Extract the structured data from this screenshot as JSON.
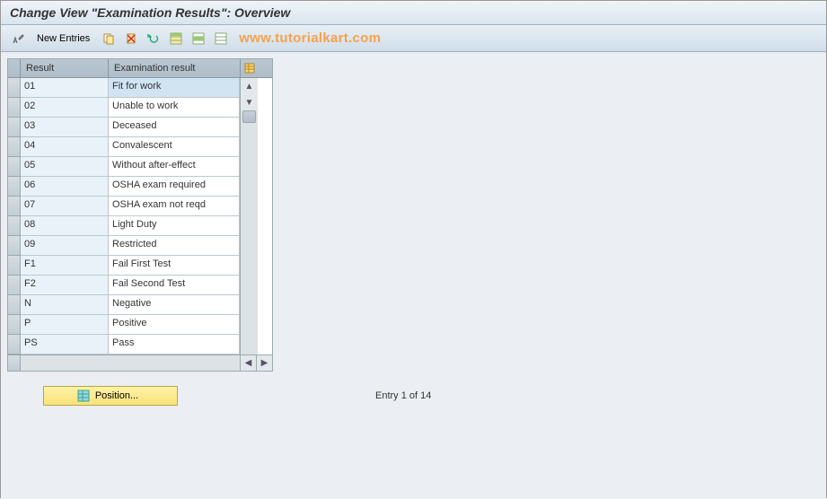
{
  "header": {
    "title": "Change View \"Examination Results\": Overview"
  },
  "toolbar": {
    "edit_icon": "edit",
    "new_entries_label": "New Entries",
    "icons": [
      "copy",
      "delete",
      "undo",
      "select-all",
      "select-block",
      "deselect-all"
    ]
  },
  "watermark": "www.tutorialkart.com",
  "table": {
    "columns": {
      "result": "Result",
      "exam": "Examination result"
    },
    "rows": [
      {
        "result": "01",
        "exam": "Fit for work",
        "selected": true
      },
      {
        "result": "02",
        "exam": "Unable to work"
      },
      {
        "result": "03",
        "exam": "Deceased"
      },
      {
        "result": "04",
        "exam": "Convalescent"
      },
      {
        "result": "05",
        "exam": "Without after-effect"
      },
      {
        "result": "06",
        "exam": "OSHA exam required"
      },
      {
        "result": "07",
        "exam": "OSHA exam not reqd"
      },
      {
        "result": "08",
        "exam": "Light Duty"
      },
      {
        "result": "09",
        "exam": "Restricted"
      },
      {
        "result": "F1",
        "exam": "Fail First Test"
      },
      {
        "result": "F2",
        "exam": "Fail Second Test"
      },
      {
        "result": "N",
        "exam": "Negative"
      },
      {
        "result": "P",
        "exam": "Positive"
      },
      {
        "result": "PS",
        "exam": "Pass"
      }
    ]
  },
  "footer": {
    "position_label": "Position...",
    "entry_status": "Entry 1 of 14"
  }
}
